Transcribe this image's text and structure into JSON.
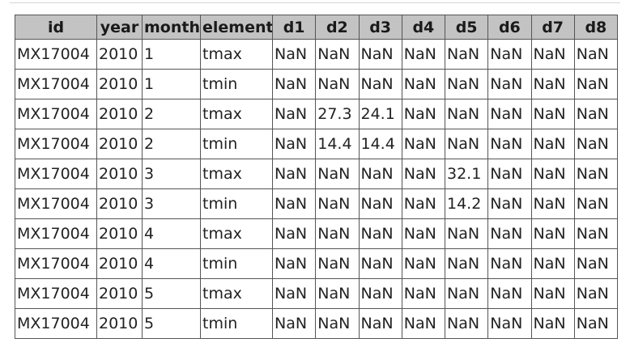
{
  "table": {
    "columns": [
      "id",
      "year",
      "month",
      "element",
      "d1",
      "d2",
      "d3",
      "d4",
      "d5",
      "d6",
      "d7",
      "d8"
    ],
    "rows": [
      [
        "MX17004",
        "2010",
        "1",
        "tmax",
        "NaN",
        "NaN",
        "NaN",
        "NaN",
        "NaN",
        "NaN",
        "NaN",
        "NaN"
      ],
      [
        "MX17004",
        "2010",
        "1",
        "tmin",
        "NaN",
        "NaN",
        "NaN",
        "NaN",
        "NaN",
        "NaN",
        "NaN",
        "NaN"
      ],
      [
        "MX17004",
        "2010",
        "2",
        "tmax",
        "NaN",
        "27.3",
        "24.1",
        "NaN",
        "NaN",
        "NaN",
        "NaN",
        "NaN"
      ],
      [
        "MX17004",
        "2010",
        "2",
        "tmin",
        "NaN",
        "14.4",
        "14.4",
        "NaN",
        "NaN",
        "NaN",
        "NaN",
        "NaN"
      ],
      [
        "MX17004",
        "2010",
        "3",
        "tmax",
        "NaN",
        "NaN",
        "NaN",
        "NaN",
        "32.1",
        "NaN",
        "NaN",
        "NaN"
      ],
      [
        "MX17004",
        "2010",
        "3",
        "tmin",
        "NaN",
        "NaN",
        "NaN",
        "NaN",
        "14.2",
        "NaN",
        "NaN",
        "NaN"
      ],
      [
        "MX17004",
        "2010",
        "4",
        "tmax",
        "NaN",
        "NaN",
        "NaN",
        "NaN",
        "NaN",
        "NaN",
        "NaN",
        "NaN"
      ],
      [
        "MX17004",
        "2010",
        "4",
        "tmin",
        "NaN",
        "NaN",
        "NaN",
        "NaN",
        "NaN",
        "NaN",
        "NaN",
        "NaN"
      ],
      [
        "MX17004",
        "2010",
        "5",
        "tmax",
        "NaN",
        "NaN",
        "NaN",
        "NaN",
        "NaN",
        "NaN",
        "NaN",
        "NaN"
      ],
      [
        "MX17004",
        "2010",
        "5",
        "tmin",
        "NaN",
        "NaN",
        "NaN",
        "NaN",
        "NaN",
        "NaN",
        "NaN",
        "NaN"
      ]
    ]
  },
  "colors": {
    "header_bg": "#c3c3c3",
    "border": "#555555",
    "text": "#222222"
  }
}
